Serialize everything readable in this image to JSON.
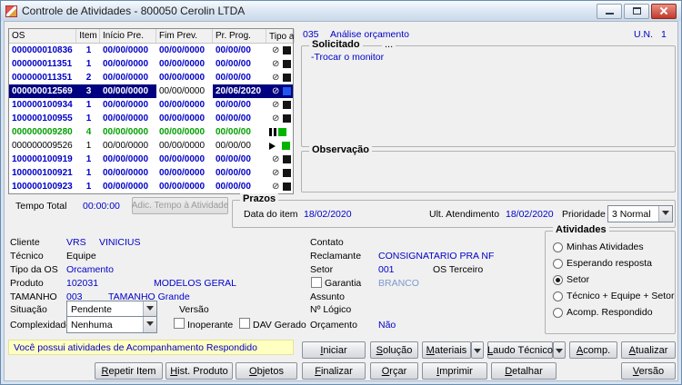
{
  "colors": {
    "blue": "#0000c8",
    "green": "#00a000",
    "selected_bg": "#000080",
    "selected_fg": "#ffffff",
    "notice_bg": "#ffffc2",
    "muted_blue": "#7a9ad0"
  },
  "titlebar": {
    "title": "Controle de Atividades - 800050 Cerolin LTDA"
  },
  "grid": {
    "headers": {
      "os": "OS",
      "item": "Item",
      "inicio": "Início Pre.",
      "fim": "Fim Prev.",
      "prog": "Pr. Prog.",
      "tipo": "Tipo ati..."
    },
    "rows": [
      {
        "os": "000000010836",
        "item": "1",
        "inicio": "00/00/0000",
        "fim": "00/00/0000",
        "prog": "00/00/00",
        "icon": "circle-slash-icon",
        "square": "black"
      },
      {
        "os": "000000011351",
        "item": "1",
        "inicio": "00/00/0000",
        "fim": "00/00/0000",
        "prog": "00/00/00",
        "icon": "circle-slash-icon",
        "square": "black"
      },
      {
        "os": "000000011351",
        "item": "2",
        "inicio": "00/00/0000",
        "fim": "00/00/0000",
        "prog": "00/00/00",
        "icon": "circle-slash-icon",
        "square": "black"
      },
      {
        "os": "000000012569",
        "item": "3",
        "inicio": "00/00/0000",
        "fim": "00/00/0000",
        "prog": "20/06/2020",
        "icon": "circle-slash-icon",
        "square": "blue",
        "selected": true
      },
      {
        "os": "100000100934",
        "item": "1",
        "inicio": "00/00/0000",
        "fim": "00/00/0000",
        "prog": "00/00/00",
        "icon": "circle-slash-icon",
        "square": "black"
      },
      {
        "os": "100000100955",
        "item": "1",
        "inicio": "00/00/0000",
        "fim": "00/00/0000",
        "prog": "00/00/00",
        "icon": "circle-slash-icon",
        "square": "black"
      },
      {
        "os": "000000009280",
        "item": "4",
        "inicio": "00/00/0000",
        "fim": "00/00/0000",
        "prog": "00/00/00",
        "icon": "pause-icon",
        "square": "green"
      },
      {
        "os": "000000009526",
        "item": "1",
        "inicio": "00/00/0000",
        "fim": "00/00/0000",
        "prog": "00/00/00",
        "icon": "play-icon",
        "square": "green"
      },
      {
        "os": "100000100919",
        "item": "1",
        "inicio": "00/00/0000",
        "fim": "00/00/0000",
        "prog": "00/00/00",
        "icon": "circle-slash-icon",
        "square": "black"
      },
      {
        "os": "100000100921",
        "item": "1",
        "inicio": "00/00/0000",
        "fim": "00/00/0000",
        "prog": "00/00/00",
        "icon": "circle-slash-icon",
        "square": "black"
      },
      {
        "os": "100000100923",
        "item": "1",
        "inicio": "00/00/0000",
        "fim": "00/00/0000",
        "prog": "00/00/00",
        "icon": "circle-slash-icon",
        "square": "black"
      }
    ]
  },
  "activity": {
    "code": "035",
    "name": "Análise orçamento",
    "un_label": "U.N.",
    "un_value": "1"
  },
  "solicitado": {
    "label": "Solicitado",
    "ellipsis": "...",
    "text": "-Trocar o monitor"
  },
  "observacao": {
    "label": "Observação"
  },
  "tempo": {
    "label": "Tempo Total",
    "value": "00:00:00",
    "add_button": "Adic. Tempo à Atividade"
  },
  "prazos": {
    "label": "Prazos",
    "data_item_label": "Data do item",
    "data_item_value": "18/02/2020",
    "ult_atendimento_label": "Ult. Atendimento",
    "ult_atendimento_value": "18/02/2020",
    "prioridade_label": "Prioridade",
    "prioridade_value": "3 Normal"
  },
  "form": {
    "cliente_label": "Cliente",
    "cliente_code": "VRS",
    "cliente_name": "VINICIUS",
    "tecnico_label": "Técnico",
    "tecnico_value": "Equipe",
    "tipo_os_label": "Tipo da OS",
    "tipo_os_value": "Orcamento",
    "produto_label": "Produto",
    "produto_code": "102031",
    "produto_name": "MODELOS GERAL",
    "tamanho_label": "TAMANHO",
    "tamanho_code": "003",
    "tamanho_name": "TAMANHO Grande",
    "situacao_label": "Situação",
    "situacao_value": "Pendente",
    "versao_label": "Versão",
    "complexidade_label": "Complexidade",
    "complexidade_value": "Nenhuma",
    "inoperante_label": "Inoperante",
    "dav_label": "DAV Gerado",
    "contato_label": "Contato",
    "reclamante_label": "Reclamante",
    "reclamante_value": "CONSIGNATARIO PRA NF",
    "setor_label": "Setor",
    "setor_value": "001",
    "os_terceiro_label": "OS Terceiro",
    "garantia_label": "Garantia",
    "garantia_value": "BRANCO",
    "assunto_label": "Assunto",
    "nlogico_label": "Nº Lógico",
    "orcamento_label": "Orçamento",
    "orcamento_value": "Não"
  },
  "atividades": {
    "label": "Atividades",
    "options": [
      {
        "label": "Minhas Atividades",
        "selected": false
      },
      {
        "label": "Esperando resposta",
        "selected": false
      },
      {
        "label": "Setor",
        "selected": true
      },
      {
        "label": "Técnico + Equipe + Setor",
        "selected": false
      },
      {
        "label": "Acomp. Respondido",
        "selected": false
      }
    ]
  },
  "notice": "Você possui atividades de Acompanhamento Respondido",
  "buttons": {
    "iniciar": "Iniciar",
    "solucao": "Solução",
    "materiais": "Materiais",
    "laudo": "Laudo Técnico",
    "acomp": "Acomp.",
    "atualizar": "Atualizar",
    "repetir": "Repetir Item",
    "hist": "Hist. Produto",
    "objetos": "Objetos",
    "finalizar": "Finalizar",
    "orcar": "Orçar",
    "imprimir": "Imprimir",
    "detalhar": "Detalhar",
    "versao": "Versão"
  }
}
